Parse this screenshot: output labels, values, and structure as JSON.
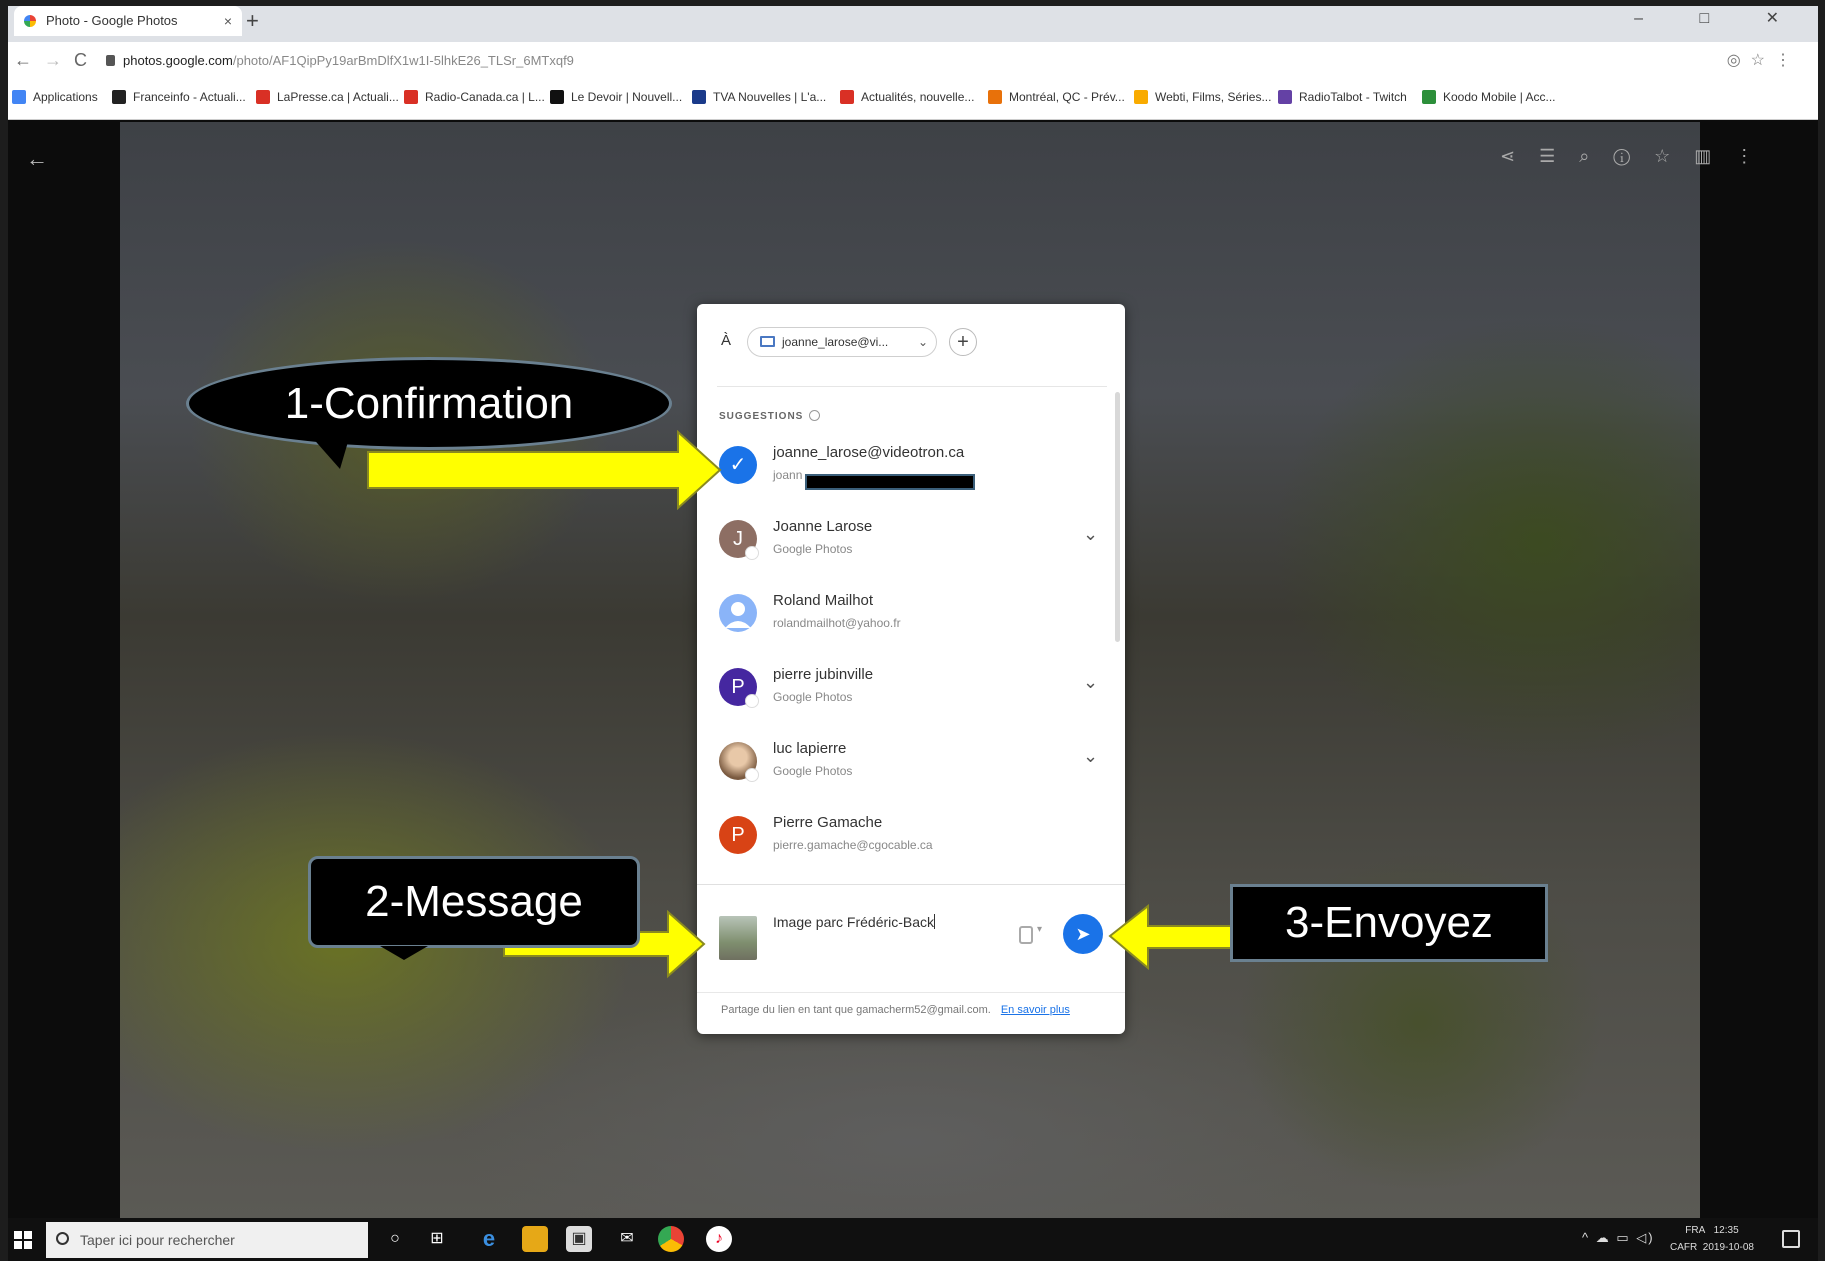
{
  "browser": {
    "tab_title": "Photo - Google Photos",
    "tab_close": "×",
    "new_tab": "+",
    "url_domain": "photos.google.com",
    "url_path": "/photo/AF1QipPy19arBmDlfX1w1I-5lhkE26_TLSr_6MTxqf9",
    "bookmarks": [
      {
        "label": "Applications",
        "color": "#4285f4"
      },
      {
        "label": "Franceinfo - Actuali...",
        "color": "#222222"
      },
      {
        "label": "LaPresse.ca | Actuali...",
        "color": "#d93025"
      },
      {
        "label": "Radio-Canada.ca | L...",
        "color": "#d93025"
      },
      {
        "label": "Le Devoir | Nouvell...",
        "color": "#111111"
      },
      {
        "label": "TVA Nouvelles | L'a...",
        "color": "#1a3a8a"
      },
      {
        "label": "Actualités, nouvelle...",
        "color": "#d93025"
      },
      {
        "label": "Montréal, QC - Prév...",
        "color": "#e8710a"
      },
      {
        "label": "Webti, Films, Séries...",
        "color": "#f9ab00"
      },
      {
        "label": "RadioTalbot - Twitch",
        "color": "#6441a5"
      },
      {
        "label": "Koodo Mobile | Acc...",
        "color": "#2c8f3a"
      }
    ]
  },
  "callouts": {
    "confirmation": "1-Confirmation",
    "message": "2-Message",
    "send": "3-Envoyez"
  },
  "dialog": {
    "to_label": "À",
    "recipient_chip": "joanne_larose@vi...",
    "suggestions_heading": "SUGGESTIONS",
    "contacts": [
      {
        "name": "joanne_larose@videotron.ca",
        "sub": "joann",
        "avatar": "✓",
        "color": "#1a73e8",
        "selected": true
      },
      {
        "name": "Joanne Larose",
        "sub": "Google Photos",
        "avatar": "J",
        "color": "#8d6e63",
        "expandable": true
      },
      {
        "name": "Roland Mailhot",
        "sub": "rolandmailhot@yahoo.fr",
        "avatar": "person",
        "color": "#8ab4f8"
      },
      {
        "name": "pierre jubinville",
        "sub": "Google Photos",
        "avatar": "P",
        "color": "#4527a0",
        "expandable": true
      },
      {
        "name": "luc lapierre",
        "sub": "Google Photos",
        "avatar": "photo",
        "color": "#b08060",
        "expandable": true
      },
      {
        "name": "Pierre Gamache",
        "sub": "pierre.gamache@cgocable.ca",
        "avatar": "P",
        "color": "#d84315"
      }
    ],
    "message_text": "Image parc Frédéric-Back",
    "footer_text": "Partage du lien en tant que gamacherm52@gmail.com.",
    "footer_link": "En savoir plus"
  },
  "taskbar": {
    "search_placeholder": "Taper ici pour rechercher",
    "lang1": "FRA",
    "lang2": "CAFR",
    "time": "12:35",
    "date": "2019-10-08"
  },
  "colors": {
    "accent": "#1a73e8",
    "arrow": "#ffff00"
  }
}
